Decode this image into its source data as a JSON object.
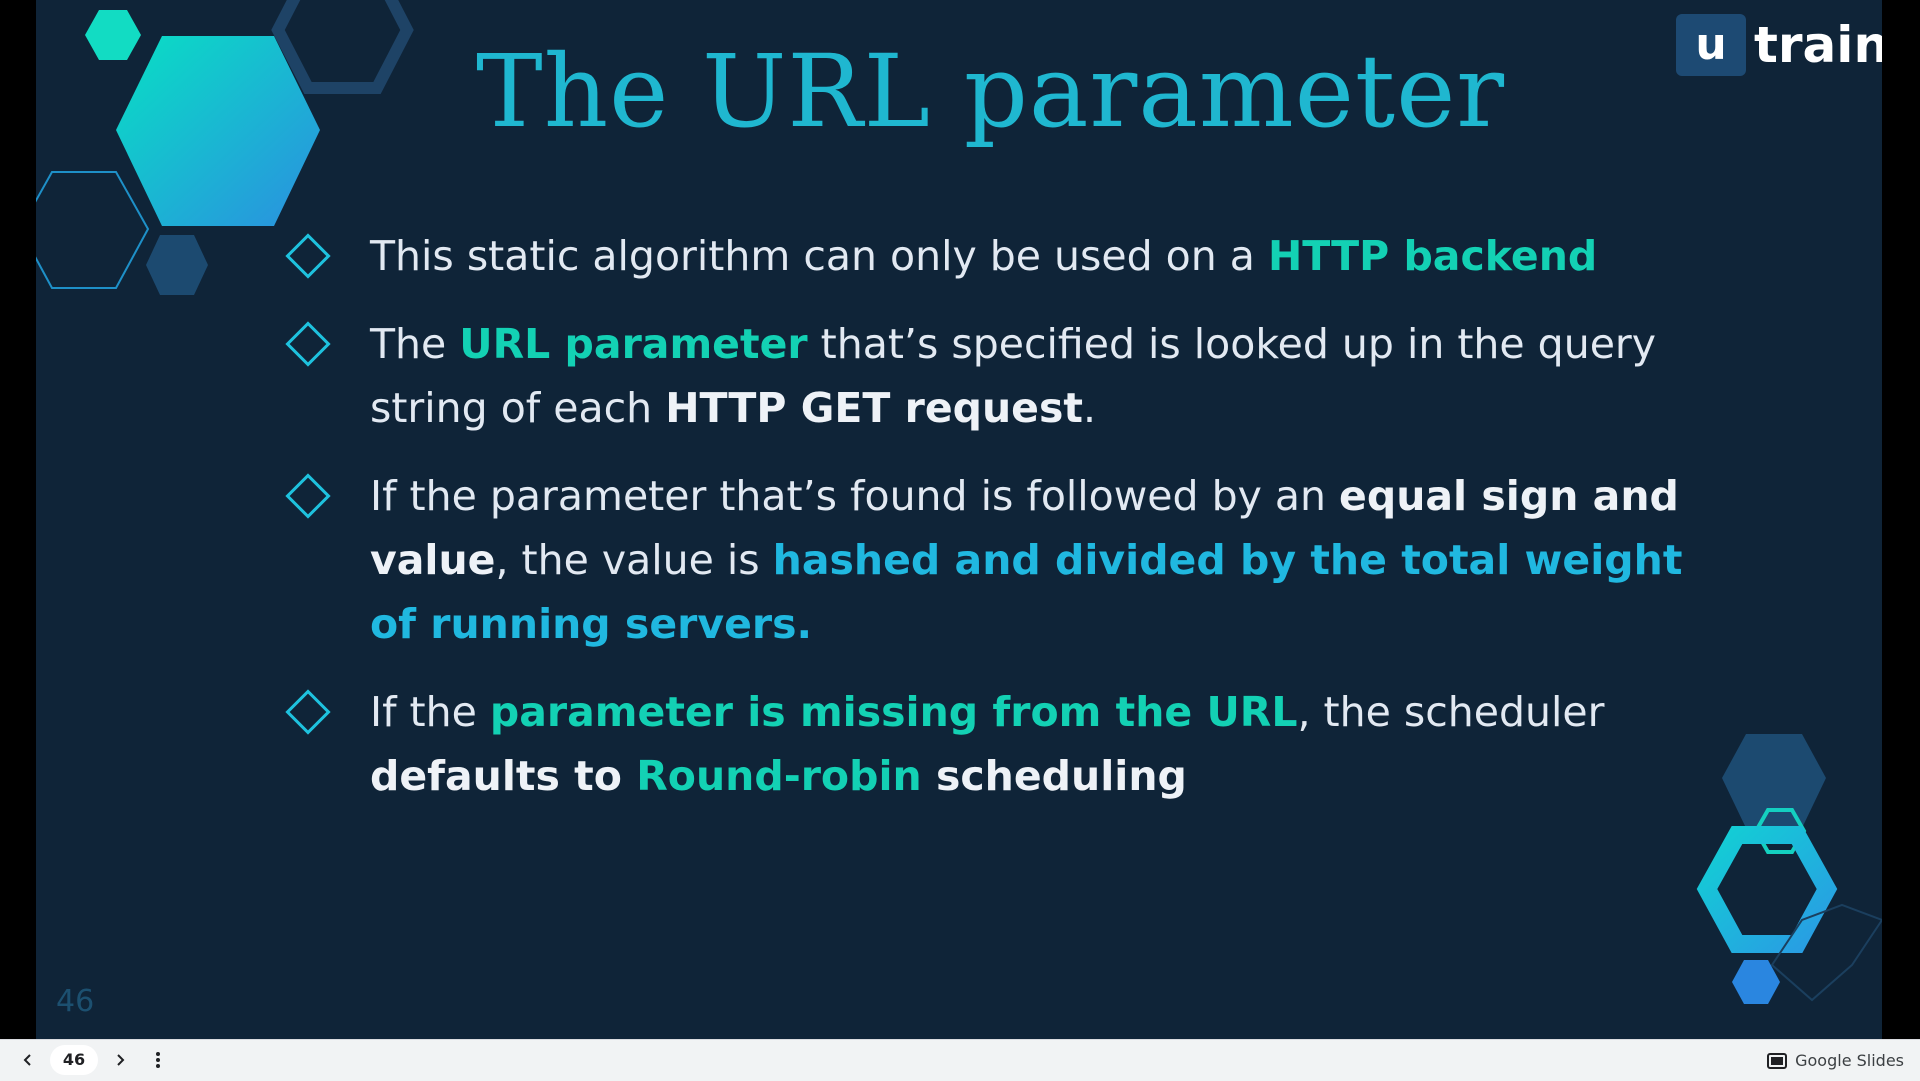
{
  "slide": {
    "title": "The URL parameter",
    "logo": {
      "mark": "u",
      "word": "train"
    },
    "number": "46",
    "bullets": [
      {
        "parts": [
          {
            "t": "This static algorithm can only be used on a ",
            "s": "n"
          },
          {
            "t": "HTTP backend",
            "s": "hl"
          }
        ]
      },
      {
        "parts": [
          {
            "t": "The ",
            "s": "n"
          },
          {
            "t": "URL parameter",
            "s": "hl"
          },
          {
            "t": " that’s specified is looked up in the query string of each ",
            "s": "n"
          },
          {
            "t": "HTTP GET request",
            "s": "strong"
          },
          {
            "t": ".",
            "s": "n"
          }
        ]
      },
      {
        "parts": [
          {
            "t": "If the parameter that’s found is followed by an ",
            "s": "n"
          },
          {
            "t": "equal sign and value",
            "s": "strong"
          },
          {
            "t": ", the value is ",
            "s": "n"
          },
          {
            "t": "hashed and divided by the total weight of running servers.",
            "s": "hl2"
          }
        ]
      },
      {
        "parts": [
          {
            "t": "If the ",
            "s": "n"
          },
          {
            "t": "parameter is missing from the URL",
            "s": "hl"
          },
          {
            "t": ", the scheduler ",
            "s": "n"
          },
          {
            "t": "defaults to ",
            "s": "strong"
          },
          {
            "t": "Round-robin",
            "s": "hl"
          },
          {
            "t": " scheduling",
            "s": "strong"
          }
        ]
      }
    ]
  },
  "toolbar": {
    "page": "46",
    "brand": "Google Slides",
    "prev_icon": "chevron-left-icon",
    "next_icon": "chevron-right-icon",
    "more_icon": "more-vertical-icon",
    "brand_icon": "slides-logo-icon"
  },
  "colors": {
    "background": "#0f2438",
    "title": "#1fb7d0",
    "highlight": "#13d1b4",
    "highlight_alt": "#20b8e0",
    "body_text": "#e2e9f2"
  }
}
